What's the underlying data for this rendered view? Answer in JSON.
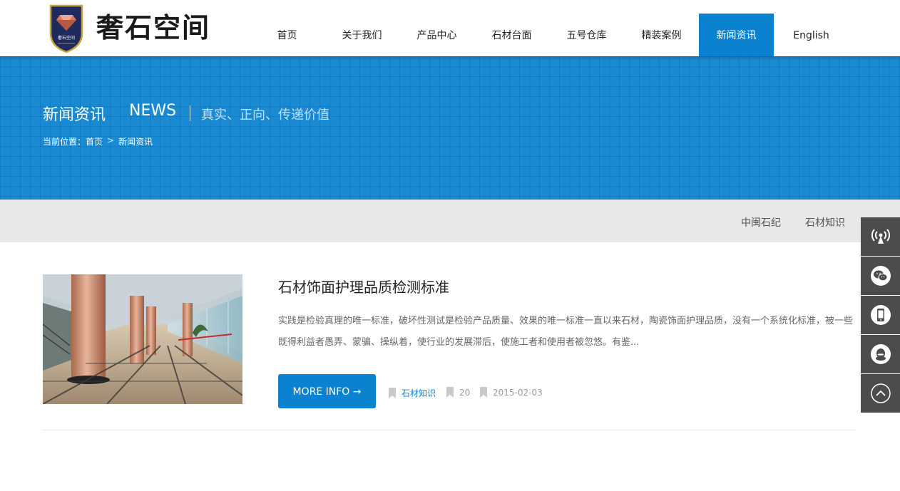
{
  "header": {
    "logo_text": "奢石空间",
    "logo_badge_text": "奢石空间",
    "nav": [
      {
        "label": "首页",
        "active": false
      },
      {
        "label": "关于我们",
        "active": false
      },
      {
        "label": "产品中心",
        "active": false
      },
      {
        "label": "石材台面",
        "active": false
      },
      {
        "label": "五号仓库",
        "active": false
      },
      {
        "label": "精装案例",
        "active": false
      },
      {
        "label": "新闻资讯",
        "active": true
      },
      {
        "label": "English",
        "active": false
      }
    ]
  },
  "banner": {
    "title": "新闻资讯",
    "title_en": "NEWS",
    "slogan": "真实、正向、传递价值",
    "breadcrumb": {
      "prefix": "当前位置：",
      "home": "首页",
      "arrow": ">",
      "current": "新闻资讯"
    }
  },
  "subnav": {
    "items": [
      "中闽石纪",
      "石材知识"
    ]
  },
  "article": {
    "title": "石材饰面护理品质检测标准",
    "description": "实践是检验真理的唯一标准，破坏性测试是检验产品质量、效果的唯一标准一直以来石材，陶瓷饰面护理品质，没有一个系统化标准，被一些既得利益者愚弄、蒙骗、操纵着，使行业的发展滞后，使施工者和使用者被忽悠。有鉴...",
    "more_label": "MORE INFO →",
    "category": "石材知识",
    "views": "20",
    "date": "2015-02-03",
    "image_icon": "lobby-photo"
  },
  "side_toolbar": {
    "icons": [
      "broadcast-icon",
      "wechat-icon",
      "mobile-icon",
      "qq-icon",
      "back-to-top-icon"
    ]
  },
  "colors": {
    "accent": "#0a82cf",
    "banner": "#1a8bd3",
    "subbar": "#e8e8e8",
    "side": "#4c4c4c"
  }
}
